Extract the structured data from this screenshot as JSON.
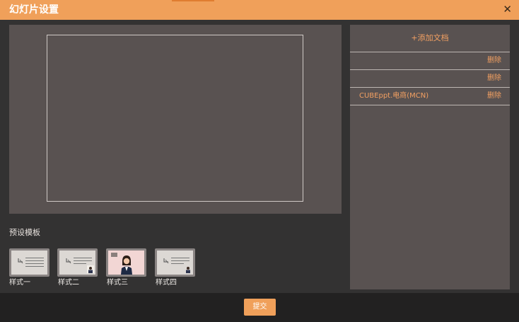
{
  "dialog": {
    "title": "幻灯片设置",
    "close_icon": "close-icon"
  },
  "templates": {
    "label": "预设模板",
    "items": [
      {
        "label": "样式一"
      },
      {
        "label": "样式二"
      },
      {
        "label": "样式三"
      },
      {
        "label": "样式四"
      }
    ]
  },
  "documents": {
    "add_label": "+添加文档",
    "delete_label": "删除",
    "items": [
      {
        "name": ""
      },
      {
        "name": ""
      },
      {
        "name": "CUBEppt.电商(MCN)"
      }
    ]
  },
  "footer": {
    "submit_label": "提交"
  },
  "colors": {
    "accent": "#f0a05a",
    "panel": "#595251",
    "background": "#333232"
  }
}
